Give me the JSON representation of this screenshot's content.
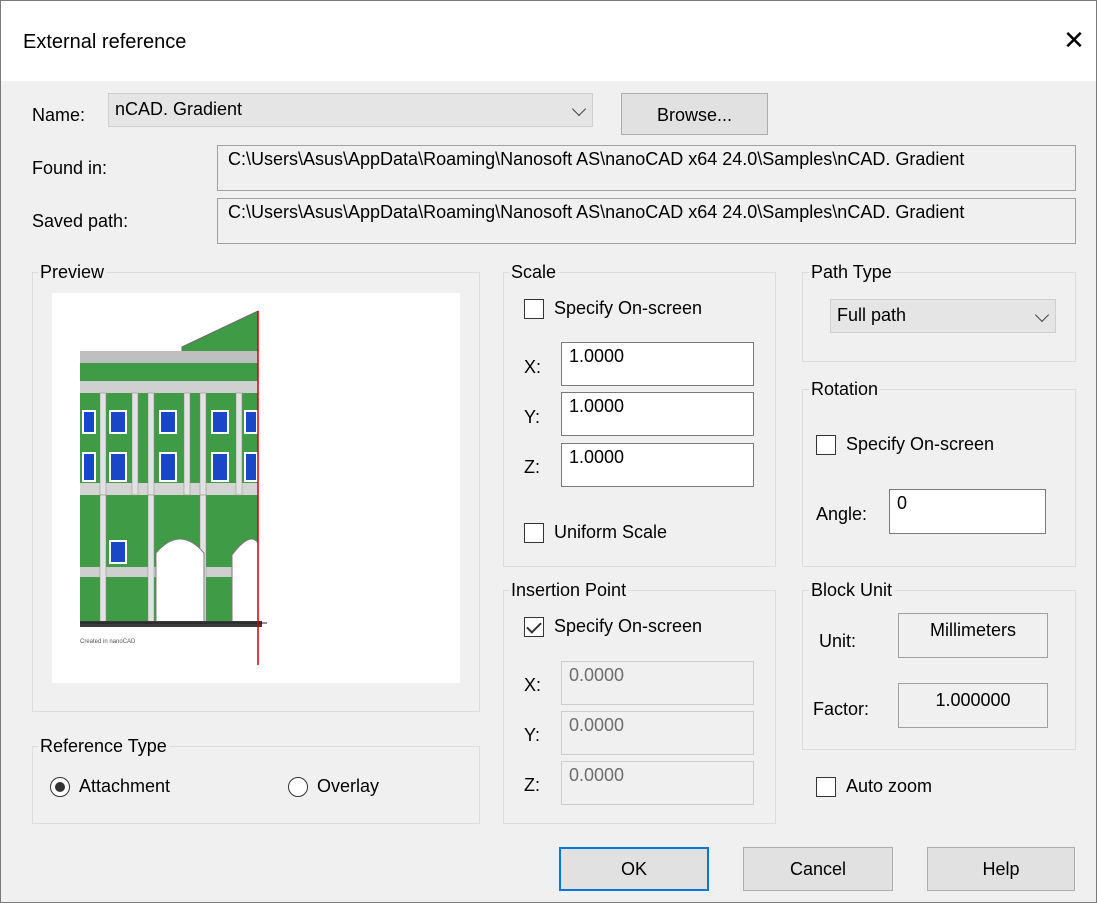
{
  "dialog": {
    "title": "External reference",
    "close_glyph": "✕"
  },
  "name": {
    "label": "Name:",
    "value": "nCAD. Gradient",
    "browse_label": "Browse..."
  },
  "found_in": {
    "label": "Found in:",
    "value": "C:\\Users\\Asus\\AppData\\Roaming\\Nanosoft AS\\nanoCAD x64 24.0\\Samples\\nCAD. Gradient"
  },
  "saved_path": {
    "label": "Saved path:",
    "value": "C:\\Users\\Asus\\AppData\\Roaming\\Nanosoft AS\\nanoCAD x64 24.0\\Samples\\nCAD. Gradient"
  },
  "preview": {
    "title": "Preview",
    "caption": "Created in nanoCAD"
  },
  "scale": {
    "title": "Scale",
    "specify_label": "Specify On-screen",
    "specify_checked": false,
    "x_label": "X:",
    "x": "1.0000",
    "y_label": "Y:",
    "y": "1.0000",
    "z_label": "Z:",
    "z": "1.0000",
    "uniform_label": "Uniform Scale",
    "uniform_checked": false
  },
  "insertion": {
    "title": "Insertion Point",
    "specify_label": "Specify On-screen",
    "specify_checked": true,
    "x_label": "X:",
    "x": "0.0000",
    "y_label": "Y:",
    "y": "0.0000",
    "z_label": "Z:",
    "z": "0.0000"
  },
  "path_type": {
    "title": "Path Type",
    "value": "Full path"
  },
  "rotation": {
    "title": "Rotation",
    "specify_label": "Specify On-screen",
    "specify_checked": false,
    "angle_label": "Angle:",
    "angle": "0"
  },
  "block_unit": {
    "title": "Block Unit",
    "unit_label": "Unit:",
    "unit": "Millimeters",
    "factor_label": "Factor:",
    "factor": "1.000000"
  },
  "auto_zoom": {
    "label": "Auto zoom",
    "checked": false
  },
  "reference_type": {
    "title": "Reference Type",
    "attachment_label": "Attachment",
    "overlay_label": "Overlay",
    "selected": "Attachment"
  },
  "buttons": {
    "ok": "OK",
    "cancel": "Cancel",
    "help": "Help"
  },
  "colors": {
    "facade_green": "#3f9b45",
    "window_blue": "#1a46c8",
    "cut_line": "#d40000",
    "accent_border": "#0078d7"
  }
}
